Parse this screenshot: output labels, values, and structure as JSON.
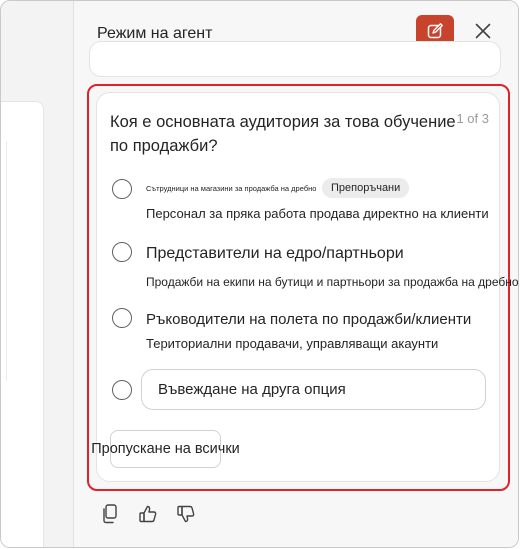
{
  "pane": {
    "title": "Режим на агент"
  },
  "question_card": {
    "question": "Коя е основната аудитория за това обучение по продажби?",
    "counter": "1 of 3",
    "options": [
      {
        "title": "Сътрудници на магазини за продажба на дребно",
        "badge": "Препоръчани",
        "description": "Персонал за пряка работа продава директно на клиенти"
      },
      {
        "title": "Представители на едро/партньори",
        "description": "Продажби на екипи на бутици и партньори за продажба на дребно"
      },
      {
        "title": "Ръководители на полета по продажби/клиенти",
        "description": "Териториални продавачи, управляващи акаунти"
      }
    ],
    "other_option": {
      "placeholder": "Въвеждане на друга опция",
      "value": ""
    },
    "skip_label": "Пропускане на всички"
  },
  "icons": {
    "new_chat": "compose-icon",
    "close": "close-icon",
    "copy": "copy-icon",
    "like": "thumbs-up-icon",
    "dislike": "thumbs-down-icon"
  },
  "colors": {
    "accent": "#c8432b",
    "highlight": "#e0202b"
  }
}
